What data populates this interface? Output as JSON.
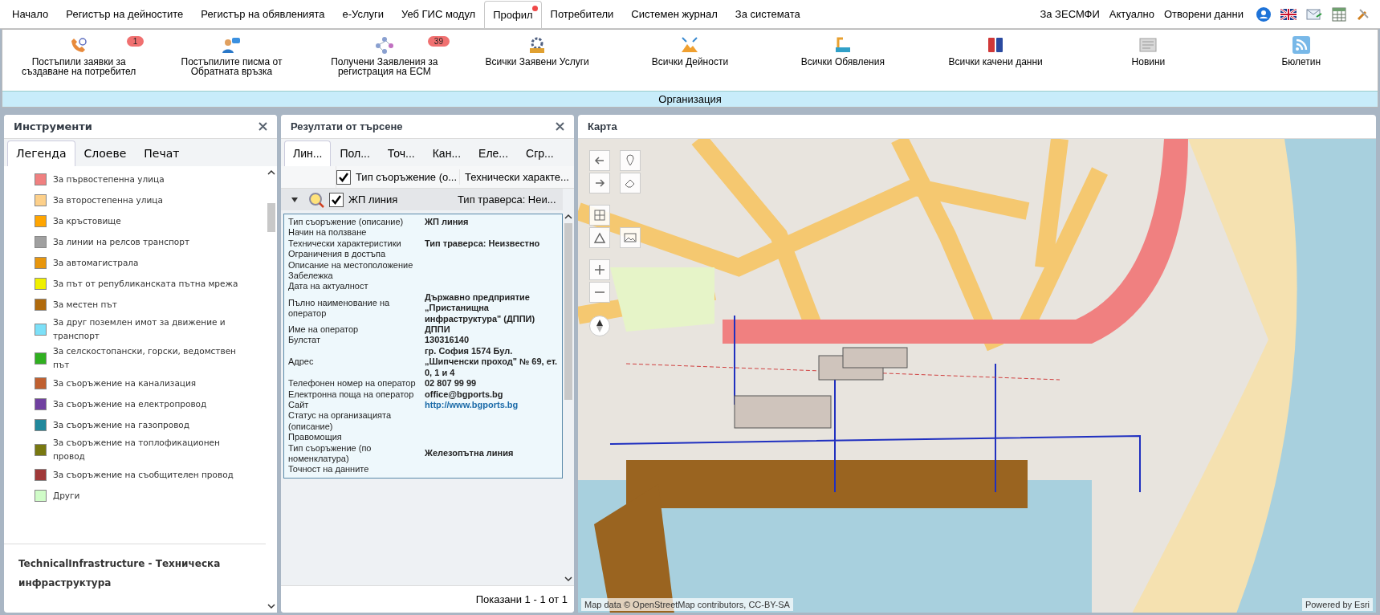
{
  "nav": {
    "items": [
      {
        "label": "Начало",
        "selected": false,
        "notification": false
      },
      {
        "label": "Регистър на дейностите",
        "selected": false,
        "notification": false
      },
      {
        "label": "Регистър на обявленията",
        "selected": false,
        "notification": false
      },
      {
        "label": "е-Услуги",
        "selected": false,
        "notification": false
      },
      {
        "label": "Уеб ГИС модул",
        "selected": false,
        "notification": false
      },
      {
        "label": "Профил",
        "selected": true,
        "notification": true
      },
      {
        "label": "Потребители",
        "selected": false,
        "notification": false
      },
      {
        "label": "Системен журнал",
        "selected": false,
        "notification": false
      },
      {
        "label": "За системата",
        "selected": false,
        "notification": false
      }
    ],
    "links": [
      "За ЗЕСМФИ",
      "Актуално",
      "Отворени данни"
    ]
  },
  "toolbar": {
    "items": [
      {
        "label": "Постъпили заявки за създаване на потребител",
        "badge": "1"
      },
      {
        "label": "Постъпилите писма от Обратната връзка"
      },
      {
        "label": "Получени Заявления за регистрация на ЕСМ",
        "badge": "39"
      },
      {
        "label": "Всички Заявени Услуги"
      },
      {
        "label": "Всички Дейности"
      },
      {
        "label": "Всички Обявления"
      },
      {
        "label": "Всички качени данни"
      },
      {
        "label": "Новини"
      },
      {
        "label": "Бюлетин"
      }
    ],
    "band": "Организация"
  },
  "tools": {
    "title": "Инструменти",
    "tabs": [
      {
        "label": "Легенда",
        "selected": true
      },
      {
        "label": "Слоеве",
        "selected": false
      },
      {
        "label": "Печат",
        "selected": false
      }
    ],
    "legend": [
      {
        "label": "За първостепенна улица",
        "color": "#f08080"
      },
      {
        "label": "За второстепенна улица",
        "color": "#fdd08a"
      },
      {
        "label": "За кръстовище",
        "color": "#ffa500"
      },
      {
        "label": "За линии на релсов транспорт",
        "color": "#a0a0a0"
      },
      {
        "label": "За автомагистрала",
        "color": "#e8960c"
      },
      {
        "label": "За път от републиканската пътна мрежа",
        "color": "#f0f000"
      },
      {
        "label": "За местен път",
        "color": "#b06a0c"
      },
      {
        "label": "За друг поземлен имот за движение и транспорт",
        "color": "#7ce0f8"
      },
      {
        "label": "За селскостопански, горски, ведомствен път",
        "color": "#30b020"
      },
      {
        "label": "За съоръжение на канализация",
        "color": "#c06030"
      },
      {
        "label": "За съоръжение на електропровод",
        "color": "#7040a0"
      },
      {
        "label": "За съоръжение на газопровод",
        "color": "#20889c"
      },
      {
        "label": "За съоръжение на топлофикационен провод",
        "color": "#787810"
      },
      {
        "label": "За съоръжение на съобщителен провод",
        "color": "#a03838"
      },
      {
        "label": "Други",
        "color": "#d0fcc8"
      }
    ],
    "section": "TechnicalInfrastructure - Техническа инфраструктура"
  },
  "results": {
    "title": "Резултати от търсене",
    "tabs": [
      {
        "label": "Лин...",
        "selected": true
      },
      {
        "label": "Пол...",
        "selected": false
      },
      {
        "label": "Точ...",
        "selected": false
      },
      {
        "label": "Кан...",
        "selected": false
      },
      {
        "label": "Еле...",
        "selected": false
      },
      {
        "label": "Сгр...",
        "selected": false
      }
    ],
    "header": {
      "checked": true,
      "columns": [
        "Тип съоръжение (о...",
        "Технически характе..."
      ]
    },
    "row": {
      "expanded": true,
      "checked": true,
      "cells": [
        "ЖП линия",
        "Тип траверса: Неи..."
      ]
    },
    "details": [
      {
        "label": "Тип съоръжение (описание)",
        "value": "ЖП линия"
      },
      {
        "label": "Начин на ползване"
      },
      {
        "label": "Технически характеристики",
        "value": "Тип траверса: Неизвестно"
      },
      {
        "label": "Ограничения в достъпа"
      },
      {
        "label": "Описание на местоположение"
      },
      {
        "label": "Забележка"
      },
      {
        "label": "Дата на актуалност"
      },
      {
        "label": "Пълно наименование на оператор",
        "value": "Държавно предприятие „Пристанищна инфраструктура\" (ДППИ)"
      },
      {
        "label": "Име на оператор",
        "value": "ДППИ"
      },
      {
        "label": "Булстат",
        "value": "130316140"
      },
      {
        "label": "Адрес",
        "value": "гр. София 1574 Бул. „Шипченски проход\" № 69, ет. 0, 1 и 4"
      },
      {
        "label": "Телефонен номер на оператор",
        "value": "02 807 99 99"
      },
      {
        "label": "Електронна поща на оператор",
        "value": "office@bgports.bg"
      },
      {
        "label": "Сайт",
        "value": "http://www.bgports.bg",
        "kind": "link"
      },
      {
        "label": "Статус на организацията (описание)"
      },
      {
        "label": "Правомощия"
      },
      {
        "label": "Тип съоръжение (по номенклатура)",
        "value": "Железопътна линия"
      },
      {
        "label": "Точност на данните"
      }
    ],
    "footer": "Показани 1 - 1 от 1"
  },
  "map": {
    "title": "Карта",
    "attribution": "Map data © OpenStreetMap contributors, CC-BY-SA",
    "powered_by": "Powered by Esri"
  }
}
